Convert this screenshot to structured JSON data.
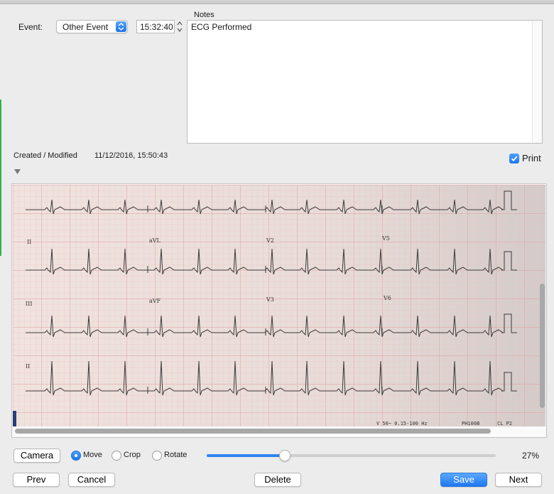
{
  "event": {
    "label": "Event:",
    "selected": "Other Event",
    "time": "15:32:40"
  },
  "notes": {
    "label": "Notes",
    "text": "ECG Performed"
  },
  "meta": {
    "created_label": "Created / Modified",
    "created_value": "11/12/2016, 15:50:43"
  },
  "print": {
    "label": "Print",
    "checked": true
  },
  "ecg_image": {
    "lead_labels": [
      "II",
      "aVL",
      "V2",
      "V5",
      "III",
      "aVF",
      "V3",
      "V6",
      "II"
    ],
    "footer_text": [
      "V 50~ 0.15-100 Hz",
      "PH100B",
      "CL P2"
    ]
  },
  "toolbar": {
    "camera": "Camera",
    "mode_move": "Move",
    "mode_crop": "Crop",
    "mode_rotate": "Rotate",
    "selected_mode": "Move",
    "zoom_fraction": 0.27,
    "zoom_label": "27%"
  },
  "footer": {
    "prev": "Prev",
    "cancel": "Cancel",
    "delete": "Delete",
    "save": "Save",
    "next": "Next"
  },
  "colors": {
    "accent": "#1f78f0",
    "grid_paper": "#e8d9d2",
    "grid_line": "#e9a3a3",
    "trace": "#3a3a3a"
  }
}
